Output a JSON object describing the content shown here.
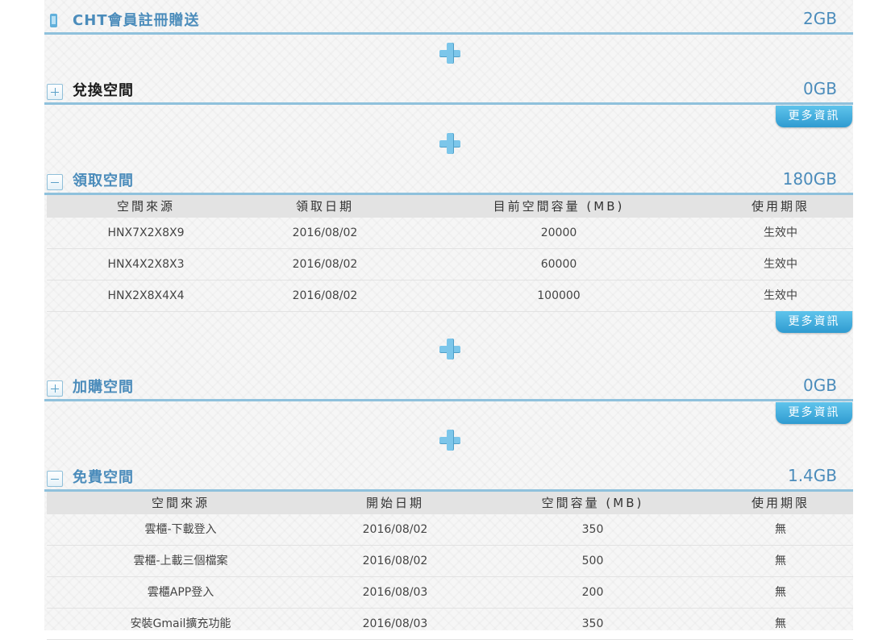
{
  "sections": {
    "cht": {
      "title": "CHT會員註冊贈送",
      "value": "2GB"
    },
    "exchange": {
      "title": "兌換空間",
      "value": "0GB",
      "more": "更多資訊"
    },
    "claim": {
      "title": "領取空間",
      "value": "180GB",
      "more": "更多資訊",
      "headers": [
        "空間來源",
        "領取日期",
        "目前空間容量 (MB)",
        "使用期限"
      ],
      "rows": [
        [
          "HNX7X2X8X9",
          "2016/08/02",
          "20000",
          "生效中"
        ],
        [
          "HNX4X2X8X3",
          "2016/08/02",
          "60000",
          "生效中"
        ],
        [
          "HNX2X8X4X4",
          "2016/08/02",
          "100000",
          "生效中"
        ]
      ]
    },
    "purchase": {
      "title": "加購空間",
      "value": "0GB",
      "more": "更多資訊"
    },
    "free": {
      "title": "免費空間",
      "value": "1.4GB",
      "headers": [
        "空間來源",
        "開始日期",
        "空間容量 (MB)",
        "使用期限"
      ],
      "rows": [
        [
          "雲櫃-下載登入",
          "2016/08/02",
          "350",
          "無"
        ],
        [
          "雲櫃-上載三個檔案",
          "2016/08/02",
          "500",
          "無"
        ],
        [
          "雲櫃APP登入",
          "2016/08/03",
          "200",
          "無"
        ],
        [
          "安裝Gmail擴充功能",
          "2016/08/03",
          "350",
          "無"
        ]
      ]
    }
  },
  "colors": {
    "accent": "#4b8cbb",
    "divider": "#8fc1dc",
    "button": "#3aa7dc",
    "dark_title": "#1a1a1a"
  }
}
